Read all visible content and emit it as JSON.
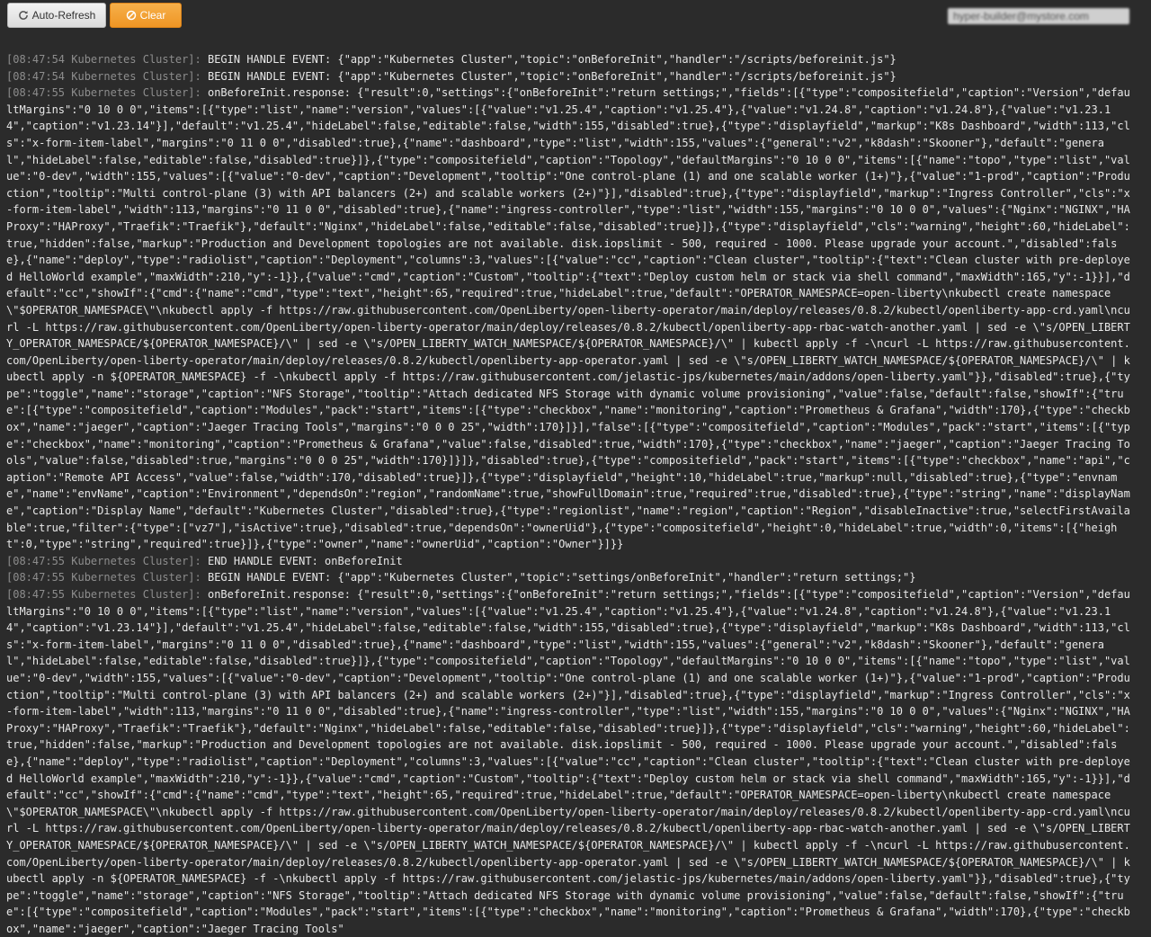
{
  "toolbar": {
    "refresh_label": "Auto-Refresh",
    "clear_label": "Clear",
    "user_email": "hyper-builder@mystore.com"
  },
  "log": [
    {
      "ts": "[08:47:54 Kubernetes Cluster]:",
      "msg": " BEGIN HANDLE EVENT: {\"app\":\"Kubernetes Cluster\",\"topic\":\"onBeforeInit\",\"handler\":\"/scripts/beforeinit.js\"}"
    },
    {
      "ts": "[08:47:54 Kubernetes Cluster]:",
      "msg": " BEGIN HANDLE EVENT: {\"app\":\"Kubernetes Cluster\",\"topic\":\"onBeforeInit\",\"handler\":\"/scripts/beforeinit.js\"}"
    },
    {
      "ts": "[08:47:55 Kubernetes Cluster]:",
      "msg": " onBeforeInit.response: {\"result\":0,\"settings\":{\"onBeforeInit\":\"return settings;\",\"fields\":[{\"type\":\"compositefield\",\"caption\":\"Version\",\"defaultMargins\":\"0 10 0 0\",\"items\":[{\"type\":\"list\",\"name\":\"version\",\"values\":[{\"value\":\"v1.25.4\",\"caption\":\"v1.25.4\"},{\"value\":\"v1.24.8\",\"caption\":\"v1.24.8\"},{\"value\":\"v1.23.14\",\"caption\":\"v1.23.14\"}],\"default\":\"v1.25.4\",\"hideLabel\":false,\"editable\":false,\"width\":155,\"disabled\":true},{\"type\":\"displayfield\",\"markup\":\"K8s Dashboard\",\"width\":113,\"cls\":\"x-form-item-label\",\"margins\":\"0 11 0 0\",\"disabled\":true},{\"name\":\"dashboard\",\"type\":\"list\",\"width\":155,\"values\":{\"general\":\"v2\",\"k8dash\":\"Skooner\"},\"default\":\"general\",\"hideLabel\":false,\"editable\":false,\"disabled\":true}]},{\"type\":\"compositefield\",\"caption\":\"Topology\",\"defaultMargins\":\"0 10 0 0\",\"items\":[{\"name\":\"topo\",\"type\":\"list\",\"value\":\"0-dev\",\"width\":155,\"values\":[{\"value\":\"0-dev\",\"caption\":\"Development\",\"tooltip\":\"One control-plane (1) and one scalable worker (1+)\"},{\"value\":\"1-prod\",\"caption\":\"Production\",\"tooltip\":\"Multi control-plane (3) with API balancers (2+) and scalable workers (2+)\"}],\"disabled\":true},{\"type\":\"displayfield\",\"markup\":\"Ingress Controller\",\"cls\":\"x-form-item-label\",\"width\":113,\"margins\":\"0 11 0 0\",\"disabled\":true},{\"name\":\"ingress-controller\",\"type\":\"list\",\"width\":155,\"margins\":\"0 10 0 0\",\"values\":{\"Nginx\":\"NGINX\",\"HAProxy\":\"HAProxy\",\"Traefik\":\"Traefik\"},\"default\":\"Nginx\",\"hideLabel\":false,\"editable\":false,\"disabled\":true}]},{\"type\":\"displayfield\",\"cls\":\"warning\",\"height\":60,\"hideLabel\":true,\"hidden\":false,\"markup\":\"Production and Development topologies are not available. disk.iopslimit - 500, required - 1000. Please upgrade your account.\",\"disabled\":false},{\"name\":\"deploy\",\"type\":\"radiolist\",\"caption\":\"Deployment\",\"columns\":3,\"values\":[{\"value\":\"cc\",\"caption\":\"Clean cluster\",\"tooltip\":{\"text\":\"Clean cluster with pre-deployed HelloWorld example\",\"maxWidth\":210,\"y\":-1}},{\"value\":\"cmd\",\"caption\":\"Custom\",\"tooltip\":{\"text\":\"Deploy custom helm or stack via shell command\",\"maxWidth\":165,\"y\":-1}}],\"default\":\"cc\",\"showIf\":{\"cmd\":{\"name\":\"cmd\",\"type\":\"text\",\"height\":65,\"required\":true,\"hideLabel\":true,\"default\":\"OPERATOR_NAMESPACE=open-liberty\\nkubectl create namespace \\\"$OPERATOR_NAMESPACE\\\"\\nkubectl apply -f https://raw.githubusercontent.com/OpenLiberty/open-liberty-operator/main/deploy/releases/0.8.2/kubectl/openliberty-app-crd.yaml\\ncurl -L https://raw.githubusercontent.com/OpenLiberty/open-liberty-operator/main/deploy/releases/0.8.2/kubectl/openliberty-app-rbac-watch-another.yaml | sed -e \\\"s/OPEN_LIBERTY_OPERATOR_NAMESPACE/${OPERATOR_NAMESPACE}/\\\" | sed -e \\\"s/OPEN_LIBERTY_WATCH_NAMESPACE/${OPERATOR_NAMESPACE}/\\\" | kubectl apply -f -\\ncurl -L https://raw.githubusercontent.com/OpenLiberty/open-liberty-operator/main/deploy/releases/0.8.2/kubectl/openliberty-app-operator.yaml | sed -e \\\"s/OPEN_LIBERTY_WATCH_NAMESPACE/${OPERATOR_NAMESPACE}/\\\" | kubectl apply -n ${OPERATOR_NAMESPACE} -f -\\nkubectl apply -f https://raw.githubusercontent.com/jelastic-jps/kubernetes/main/addons/open-liberty.yaml\"}},\"disabled\":true},{\"type\":\"toggle\",\"name\":\"storage\",\"caption\":\"NFS Storage\",\"tooltip\":\"Attach dedicated NFS Storage with dynamic volume provisioning\",\"value\":false,\"default\":false,\"showIf\":{\"true\":[{\"type\":\"compositefield\",\"caption\":\"Modules\",\"pack\":\"start\",\"items\":[{\"type\":\"checkbox\",\"name\":\"monitoring\",\"caption\":\"Prometheus & Grafana\",\"width\":170},{\"type\":\"checkbox\",\"name\":\"jaeger\",\"caption\":\"Jaeger Tracing Tools\",\"margins\":\"0 0 0 25\",\"width\":170}]}],\"false\":[{\"type\":\"compositefield\",\"caption\":\"Modules\",\"pack\":\"start\",\"items\":[{\"type\":\"checkbox\",\"name\":\"monitoring\",\"caption\":\"Prometheus & Grafana\",\"value\":false,\"disabled\":true,\"width\":170},{\"type\":\"checkbox\",\"name\":\"jaeger\",\"caption\":\"Jaeger Tracing Tools\",\"value\":false,\"disabled\":true,\"margins\":\"0 0 0 25\",\"width\":170}]}]},\"disabled\":true},{\"type\":\"compositefield\",\"pack\":\"start\",\"items\":[{\"type\":\"checkbox\",\"name\":\"api\",\"caption\":\"Remote API Access\",\"value\":false,\"width\":170,\"disabled\":true}]},{\"type\":\"displayfield\",\"height\":10,\"hideLabel\":true,\"markup\":null,\"disabled\":true},{\"type\":\"envname\",\"name\":\"envName\",\"caption\":\"Environment\",\"dependsOn\":\"region\",\"randomName\":true,\"showFullDomain\":true,\"required\":true,\"disabled\":true},{\"type\":\"string\",\"name\":\"displayName\",\"caption\":\"Display Name\",\"default\":\"Kubernetes Cluster\",\"disabled\":true},{\"type\":\"regionlist\",\"name\":\"region\",\"caption\":\"Region\",\"disableInactive\":true,\"selectFirstAvailable\":true,\"filter\":{\"type\":[\"vz7\"],\"isActive\":true},\"disabled\":true,\"dependsOn\":\"ownerUid\"},{\"type\":\"compositefield\",\"height\":0,\"hideLabel\":true,\"width\":0,\"items\":[{\"height\":0,\"type\":\"string\",\"required\":true}]},{\"type\":\"owner\",\"name\":\"ownerUid\",\"caption\":\"Owner\"}]}}"
    },
    {
      "ts": "[08:47:55 Kubernetes Cluster]:",
      "msg": " END HANDLE EVENT: onBeforeInit"
    },
    {
      "ts": "[08:47:55 Kubernetes Cluster]:",
      "msg": " BEGIN HANDLE EVENT: {\"app\":\"Kubernetes Cluster\",\"topic\":\"settings/onBeforeInit\",\"handler\":\"return settings;\"}"
    },
    {
      "ts": "[08:47:55 Kubernetes Cluster]:",
      "msg": " onBeforeInit.response: {\"result\":0,\"settings\":{\"onBeforeInit\":\"return settings;\",\"fields\":[{\"type\":\"compositefield\",\"caption\":\"Version\",\"defaultMargins\":\"0 10 0 0\",\"items\":[{\"type\":\"list\",\"name\":\"version\",\"values\":[{\"value\":\"v1.25.4\",\"caption\":\"v1.25.4\"},{\"value\":\"v1.24.8\",\"caption\":\"v1.24.8\"},{\"value\":\"v1.23.14\",\"caption\":\"v1.23.14\"}],\"default\":\"v1.25.4\",\"hideLabel\":false,\"editable\":false,\"width\":155,\"disabled\":true},{\"type\":\"displayfield\",\"markup\":\"K8s Dashboard\",\"width\":113,\"cls\":\"x-form-item-label\",\"margins\":\"0 11 0 0\",\"disabled\":true},{\"name\":\"dashboard\",\"type\":\"list\",\"width\":155,\"values\":{\"general\":\"v2\",\"k8dash\":\"Skooner\"},\"default\":\"general\",\"hideLabel\":false,\"editable\":false,\"disabled\":true}]},{\"type\":\"compositefield\",\"caption\":\"Topology\",\"defaultMargins\":\"0 10 0 0\",\"items\":[{\"name\":\"topo\",\"type\":\"list\",\"value\":\"0-dev\",\"width\":155,\"values\":[{\"value\":\"0-dev\",\"caption\":\"Development\",\"tooltip\":\"One control-plane (1) and one scalable worker (1+)\"},{\"value\":\"1-prod\",\"caption\":\"Production\",\"tooltip\":\"Multi control-plane (3) with API balancers (2+) and scalable workers (2+)\"}],\"disabled\":true},{\"type\":\"displayfield\",\"markup\":\"Ingress Controller\",\"cls\":\"x-form-item-label\",\"width\":113,\"margins\":\"0 11 0 0\",\"disabled\":true},{\"name\":\"ingress-controller\",\"type\":\"list\",\"width\":155,\"margins\":\"0 10 0 0\",\"values\":{\"Nginx\":\"NGINX\",\"HAProxy\":\"HAProxy\",\"Traefik\":\"Traefik\"},\"default\":\"Nginx\",\"hideLabel\":false,\"editable\":false,\"disabled\":true}]},{\"type\":\"displayfield\",\"cls\":\"warning\",\"height\":60,\"hideLabel\":true,\"hidden\":false,\"markup\":\"Production and Development topologies are not available. disk.iopslimit - 500, required - 1000. Please upgrade your account.\",\"disabled\":false},{\"name\":\"deploy\",\"type\":\"radiolist\",\"caption\":\"Deployment\",\"columns\":3,\"values\":[{\"value\":\"cc\",\"caption\":\"Clean cluster\",\"tooltip\":{\"text\":\"Clean cluster with pre-deployed HelloWorld example\",\"maxWidth\":210,\"y\":-1}},{\"value\":\"cmd\",\"caption\":\"Custom\",\"tooltip\":{\"text\":\"Deploy custom helm or stack via shell command\",\"maxWidth\":165,\"y\":-1}}],\"default\":\"cc\",\"showIf\":{\"cmd\":{\"name\":\"cmd\",\"type\":\"text\",\"height\":65,\"required\":true,\"hideLabel\":true,\"default\":\"OPERATOR_NAMESPACE=open-liberty\\nkubectl create namespace \\\"$OPERATOR_NAMESPACE\\\"\\nkubectl apply -f https://raw.githubusercontent.com/OpenLiberty/open-liberty-operator/main/deploy/releases/0.8.2/kubectl/openliberty-app-crd.yaml\\ncurl -L https://raw.githubusercontent.com/OpenLiberty/open-liberty-operator/main/deploy/releases/0.8.2/kubectl/openliberty-app-rbac-watch-another.yaml | sed -e \\\"s/OPEN_LIBERTY_OPERATOR_NAMESPACE/${OPERATOR_NAMESPACE}/\\\" | sed -e \\\"s/OPEN_LIBERTY_WATCH_NAMESPACE/${OPERATOR_NAMESPACE}/\\\" | kubectl apply -f -\\ncurl -L https://raw.githubusercontent.com/OpenLiberty/open-liberty-operator/main/deploy/releases/0.8.2/kubectl/openliberty-app-operator.yaml | sed -e \\\"s/OPEN_LIBERTY_WATCH_NAMESPACE/${OPERATOR_NAMESPACE}/\\\" | kubectl apply -n ${OPERATOR_NAMESPACE} -f -\\nkubectl apply -f https://raw.githubusercontent.com/jelastic-jps/kubernetes/main/addons/open-liberty.yaml\"}},\"disabled\":true},{\"type\":\"toggle\",\"name\":\"storage\",\"caption\":\"NFS Storage\",\"tooltip\":\"Attach dedicated NFS Storage with dynamic volume provisioning\",\"value\":false,\"default\":false,\"showIf\":{\"true\":[{\"type\":\"compositefield\",\"caption\":\"Modules\",\"pack\":\"start\",\"items\":[{\"type\":\"checkbox\",\"name\":\"monitoring\",\"caption\":\"Prometheus & Grafana\",\"width\":170},{\"type\":\"checkbox\",\"name\":\"jaeger\",\"caption\":\"Jaeger Tracing Tools\""
    }
  ]
}
